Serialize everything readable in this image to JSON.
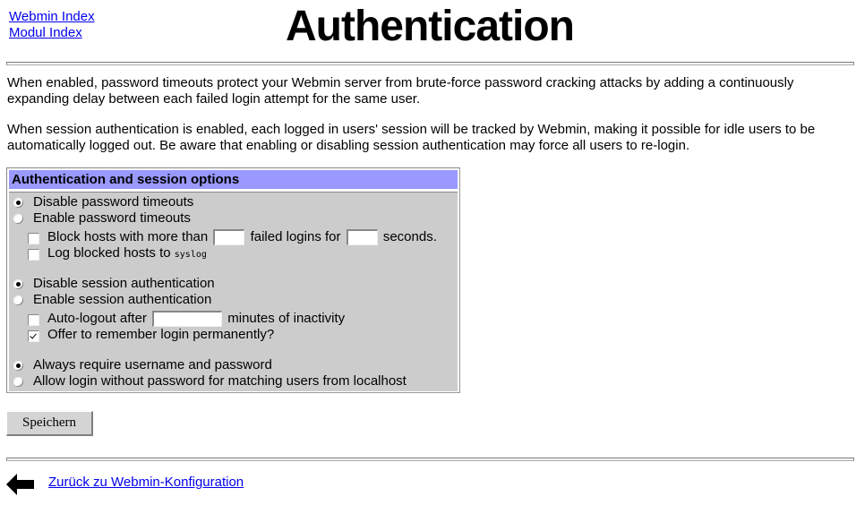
{
  "header": {
    "links": [
      {
        "label": "Webmin Index"
      },
      {
        "label": "Modul Index"
      }
    ],
    "title": "Authentication"
  },
  "intro": {
    "paragraphs": [
      "When enabled, password timeouts protect your Webmin server from brute-force password cracking attacks by adding a continuously expanding delay between each failed login attempt for the same user.",
      "When session authentication is enabled, each logged in users' session will be tracked by Webmin, making it possible for idle users to be automatically logged out. Be aware that enabling or disabling session authentication may force all users to re-login."
    ]
  },
  "options": {
    "header": "Authentication and session options",
    "header_color": "#9999ff",
    "body_color": "#cccccc",
    "password_timeouts": {
      "disable_label": "Disable password timeouts",
      "enable_label": "Enable password timeouts",
      "selected": "disable",
      "block_hosts": {
        "checked": false,
        "prefix": "Block hosts with more than",
        "failures_value": "",
        "middle": "failed logins for",
        "seconds_value": "",
        "suffix": "seconds."
      },
      "log_blocked": {
        "checked": false,
        "label": "Log blocked hosts to",
        "target": "syslog"
      }
    },
    "session_auth": {
      "disable_label": "Disable session authentication",
      "enable_label": "Enable session authentication",
      "selected": "disable",
      "auto_logout": {
        "checked": false,
        "prefix": "Auto-logout after",
        "minutes_value": "",
        "suffix": "minutes of inactivity"
      },
      "remember_login": {
        "checked": true,
        "label": "Offer to remember login permanently?"
      }
    },
    "localhost_login": {
      "always_label": "Always require username and password",
      "allow_label": "Allow login without password for matching users from localhost",
      "selected": "always"
    }
  },
  "actions": {
    "save_label": "Speichern"
  },
  "footer": {
    "back_icon": "left-arrow-icon",
    "back_label": "Zurück zu Webmin-Konfiguration"
  }
}
